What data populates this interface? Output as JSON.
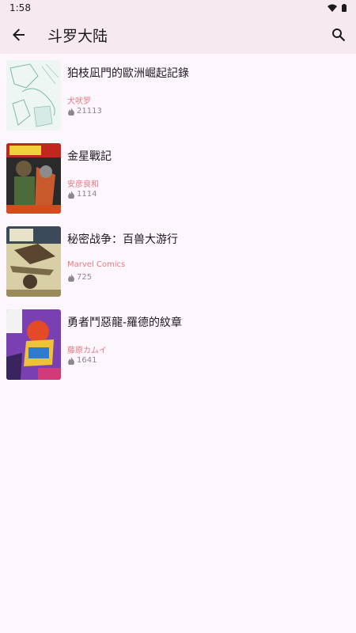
{
  "status": {
    "time": "1:58"
  },
  "header": {
    "title": "斗罗大陆"
  },
  "items": [
    {
      "title": "狛枝凪門的歐洲崛起記錄",
      "author": "犬吠罗",
      "views": "21113"
    },
    {
      "title": "金星戰記",
      "author": "安彦良和",
      "views": "1114"
    },
    {
      "title": "秘密战争：百兽大游行",
      "author": "Marvel Comics",
      "views": "725"
    },
    {
      "title": "勇者鬥惡龍-羅德的紋章",
      "author": "藤原カムイ",
      "views": "1641"
    }
  ],
  "colors": {
    "accent_author": "#e27a82",
    "appbar": "#f6e9f0",
    "background": "#fdf7fd"
  }
}
